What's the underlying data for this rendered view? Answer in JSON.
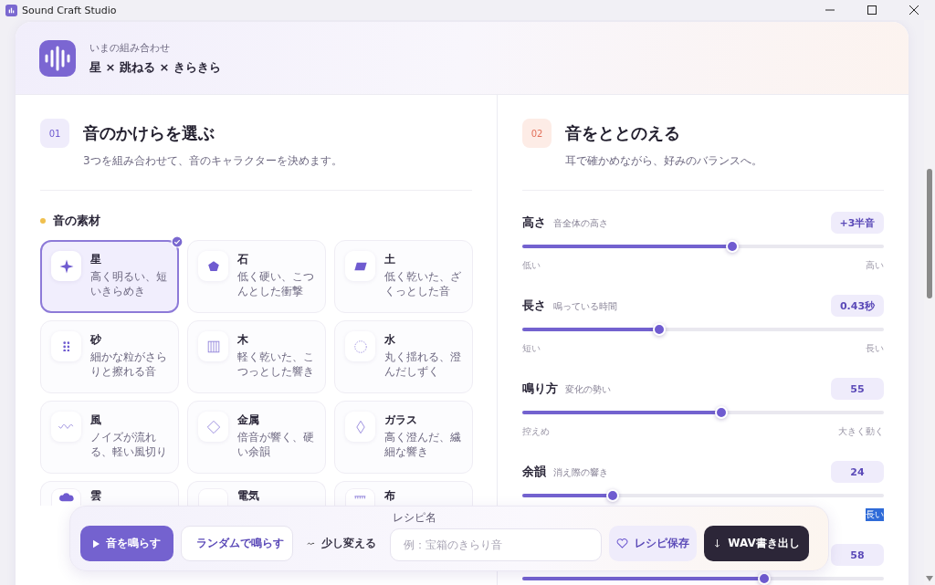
{
  "window": {
    "title": "Sound Craft Studio"
  },
  "header": {
    "label": "いまの組み合わせ",
    "combination": "星 × 跳ねる × きらきら"
  },
  "pick_section": {
    "number": "01",
    "title": "音のかけらを選ぶ",
    "subtitle": "3つを組み合わせて、音のキャラクターを決めます。",
    "group_title": "音の素材",
    "materials": [
      {
        "name": "星",
        "description": "高く明るい、短いきらめき",
        "selected": true
      },
      {
        "name": "石",
        "description": "低く硬い、こつんとした衝撃",
        "selected": false
      },
      {
        "name": "土",
        "description": "低く乾いた、ざくっとした音",
        "selected": false
      },
      {
        "name": "砂",
        "description": "細かな粒がさらりと擦れる音",
        "selected": false
      },
      {
        "name": "木",
        "description": "軽く乾いた、こつっとした響き",
        "selected": false
      },
      {
        "name": "水",
        "description": "丸く揺れる、澄んだしずく",
        "selected": false
      },
      {
        "name": "風",
        "description": "ノイズが流れる、軽い風切り",
        "selected": false
      },
      {
        "name": "金属",
        "description": "倍音が響く、硬い余韻",
        "selected": false
      },
      {
        "name": "ガラス",
        "description": "高く澄んだ、繊細な響き",
        "selected": false
      },
      {
        "name": "雲",
        "selected": false
      },
      {
        "name": "電気",
        "selected": false
      },
      {
        "name": "布",
        "selected": false
      }
    ]
  },
  "tune_section": {
    "number": "02",
    "title": "音をととのえる",
    "subtitle": "耳で確かめながら、好みのバランスへ。",
    "sliders": [
      {
        "label": "高さ",
        "hint": "音全体の高さ",
        "value": "+3半音",
        "level": 0.58,
        "min_label": "低い",
        "max_label": "高い"
      },
      {
        "label": "長さ",
        "hint": "鳴っている時間",
        "value": "0.43秒",
        "level": 0.38,
        "min_label": "短い",
        "max_label": "長い"
      },
      {
        "label": "鳴り方",
        "hint": "変化の勢い",
        "value": "55",
        "level": 0.55,
        "min_label": "控えめ",
        "max_label": "大きく動く"
      },
      {
        "label": "余韻",
        "hint": "消え際の響き",
        "value": "24",
        "level": 0.25,
        "max_label": "長い",
        "max_label_highlighted": true
      },
      {
        "value": "58",
        "level": 0.67
      }
    ]
  },
  "action_bar": {
    "play": "音を鳴らす",
    "random": "ランダムで鳴らす",
    "tweak": "少し変える",
    "recipe_label": "レシピ名",
    "recipe_placeholder": "例：宝箱のきらり音",
    "save": "レシピ保存",
    "export": "WAV書き出し"
  }
}
